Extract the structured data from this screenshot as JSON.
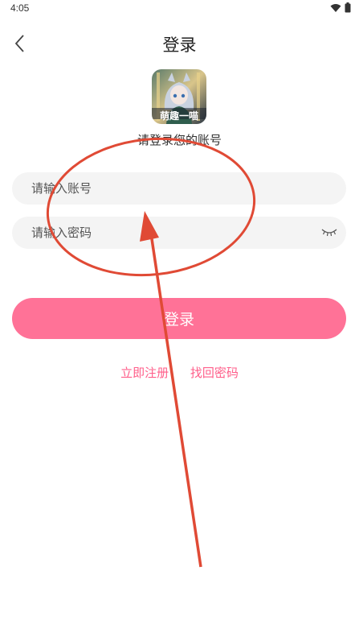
{
  "status_bar": {
    "time": "4:05",
    "icons": [
      "wifi-icon",
      "battery-icon"
    ]
  },
  "header": {
    "title": "登录",
    "back_icon": "chevron-left-icon"
  },
  "logo": {
    "text": "萌趣一喵"
  },
  "subtitle": "请登录您的账号",
  "form": {
    "account_placeholder": "请输入账号",
    "account_value": "",
    "password_placeholder": "请输入密码",
    "password_value": "",
    "password_toggle_icon": "eye-closed-icon"
  },
  "login_button": "登录",
  "links": {
    "register": "立即注册",
    "forgot": "找回密码"
  },
  "colors": {
    "accent": "#ff7297",
    "link": "#ff5e8a",
    "field_bg": "#f4f4f4",
    "annotation": "#e04a35"
  }
}
